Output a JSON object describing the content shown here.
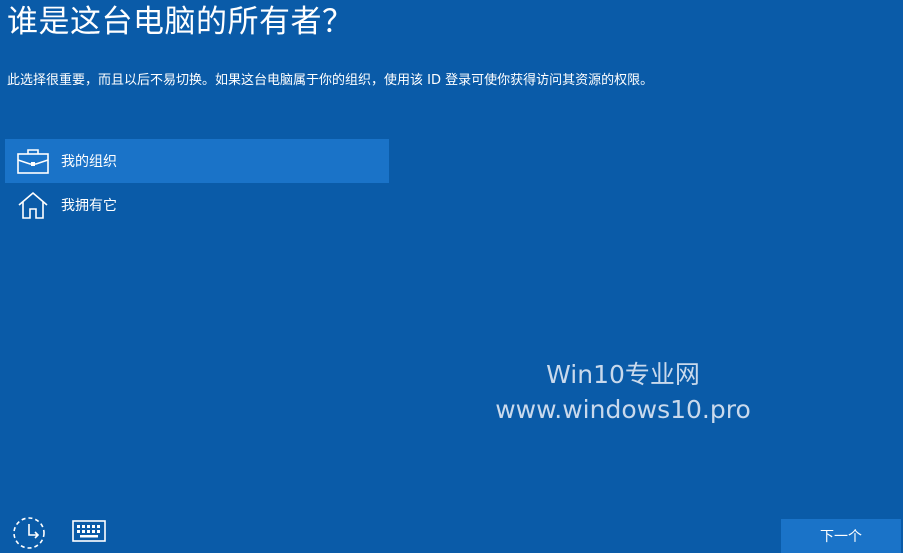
{
  "page": {
    "title": "谁是这台电脑的所有者？",
    "description": "此选择很重要，而且以后不易切换。如果这台电脑属于你的组织，使用该 ID 登录可使你获得访问其资源的权限。"
  },
  "options": [
    {
      "label": "我的组织",
      "icon": "briefcase-icon",
      "selected": true
    },
    {
      "label": "我拥有它",
      "icon": "home-icon",
      "selected": false
    }
  ],
  "watermark": {
    "line1": "Win10专业网",
    "line2": "www.windows10.pro"
  },
  "footer": {
    "accessibility_icon": "ease-of-access-icon",
    "keyboard_icon": "keyboard-icon",
    "next_label": "下一个"
  },
  "colors": {
    "background": "#0a5ba8",
    "selected_option": "#1a73c8",
    "button": "#1a73c8",
    "watermark": "#c9d9ec"
  }
}
